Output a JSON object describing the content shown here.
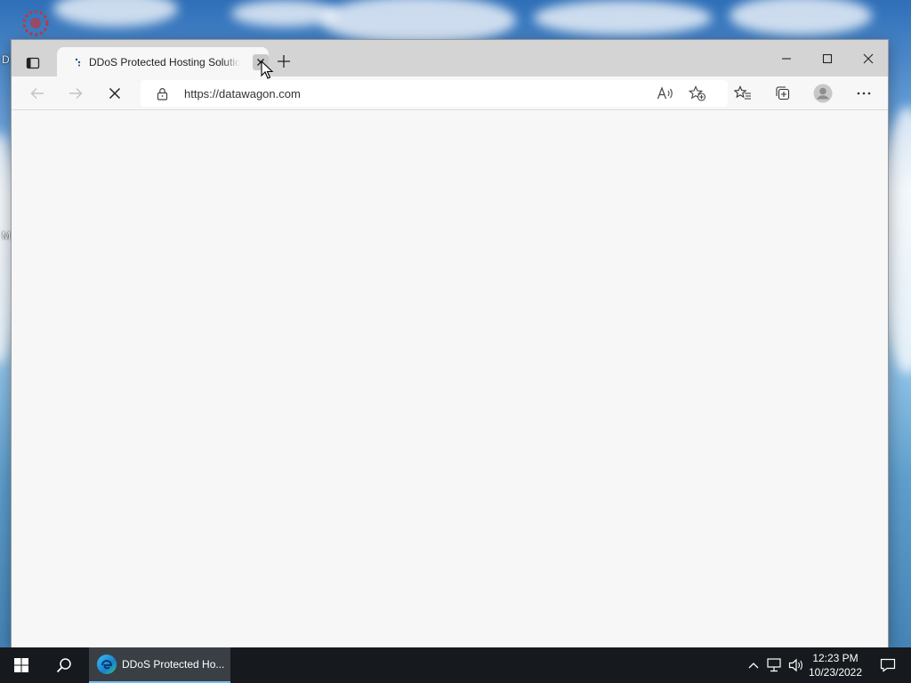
{
  "browser": {
    "tab": {
      "title": "DDoS Protected Hosting Solutions"
    },
    "address": {
      "url": "https://datawagon.com"
    }
  },
  "taskbar": {
    "active_app_label": "DDoS Protected Ho...",
    "clock": {
      "time": "12:23 PM",
      "date": "10/23/2022"
    }
  },
  "colors": {
    "titlebar": "#d4d4d4",
    "page_background": "#f7f7f7",
    "taskbar": "#16191d",
    "taskbar_active": "#3a3f45",
    "accent": "#76b9ed"
  },
  "icons": {
    "tab_actions": "tab-actions-icon",
    "favicon": "loading-dots-icon",
    "tab_close": "close-icon",
    "new_tab": "plus-icon",
    "minimize": "minimize-icon",
    "maximize": "maximize-icon",
    "close_window": "close-icon",
    "back": "arrow-left-icon",
    "forward": "arrow-right-icon",
    "stop": "stop-icon",
    "lock": "lock-icon",
    "read_aloud": "read-aloud-icon",
    "add_favorite": "star-add-icon",
    "favorites": "favorites-icon",
    "collections": "collections-icon",
    "profile": "profile-icon",
    "more": "more-icon",
    "start": "windows-icon",
    "search": "search-icon",
    "edge": "edge-icon",
    "tray_chevron": "chevron-up-icon",
    "network": "network-icon",
    "volume": "volume-icon",
    "notifications": "notification-icon"
  }
}
